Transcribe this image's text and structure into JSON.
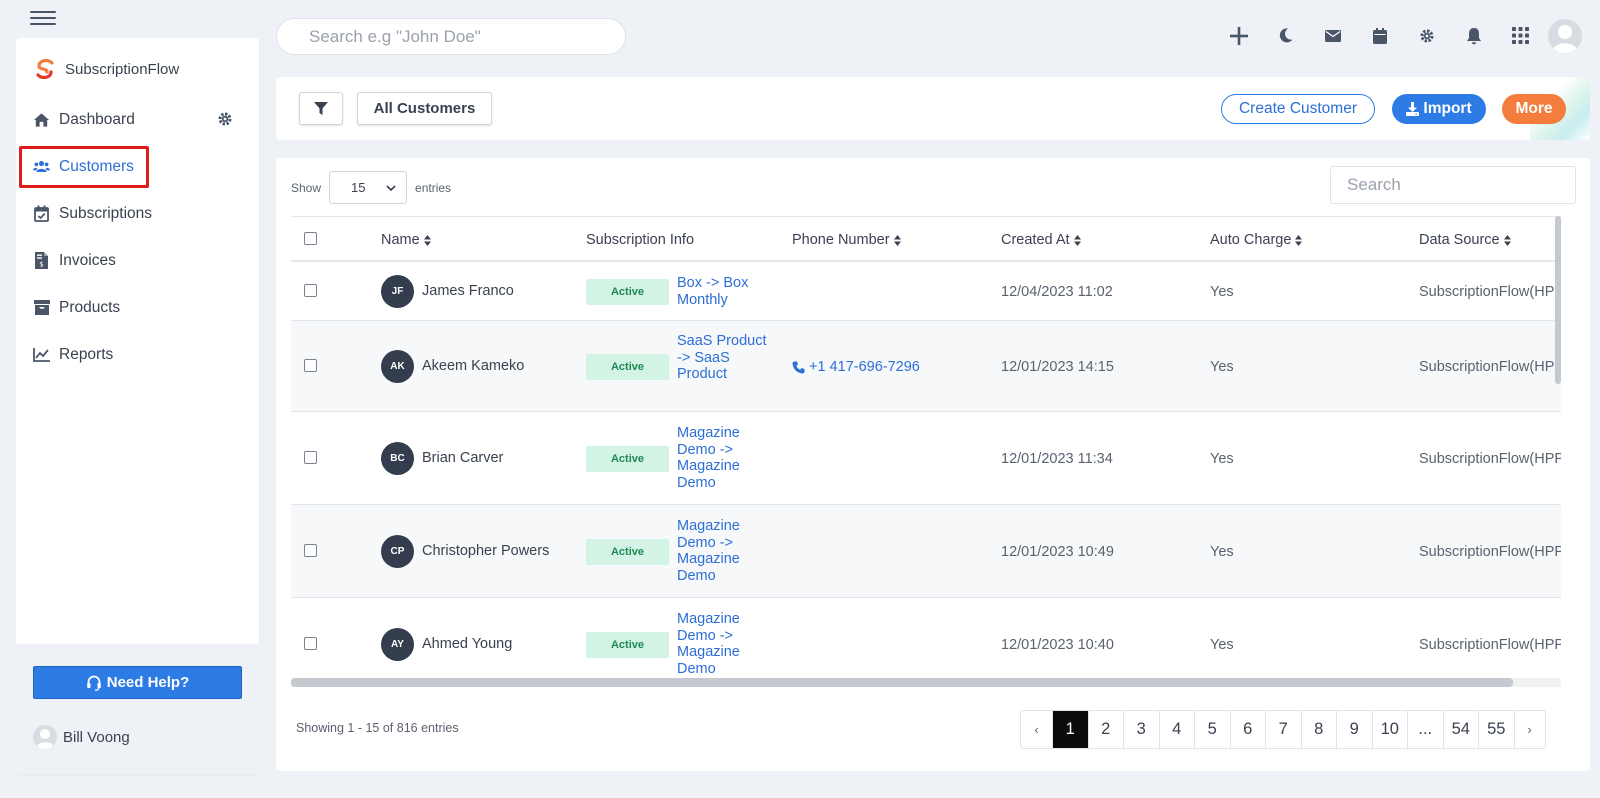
{
  "brand": {
    "name": "SubscriptionFlow"
  },
  "top_search": {
    "placeholder": "Search e.g \"John Doe\""
  },
  "sidebar": {
    "items": [
      {
        "label": "Dashboard",
        "icon": "home-icon"
      },
      {
        "label": "Customers",
        "icon": "users-icon",
        "active": true
      },
      {
        "label": "Subscriptions",
        "icon": "calendar-check-icon"
      },
      {
        "label": "Invoices",
        "icon": "invoice-icon"
      },
      {
        "label": "Products",
        "icon": "archive-icon"
      },
      {
        "label": "Reports",
        "icon": "chart-line-icon"
      }
    ],
    "help_label": "Need Help?",
    "user_name": "Bill Voong"
  },
  "toolbar": {
    "view_label": "All Customers",
    "create_label": "Create Customer",
    "import_label": "Import",
    "more_label": "More"
  },
  "table": {
    "show_label": "Show",
    "entries_value": "15",
    "entries_label": "entries",
    "search_placeholder": "Search",
    "columns": [
      "Name",
      "Subscription Info",
      "Phone Number",
      "Created At",
      "Auto Charge",
      "Data Source"
    ],
    "rows": [
      {
        "initials": "JF",
        "name": "James Franco",
        "status": "Active",
        "subscription": "Box -> Box Monthly",
        "phone": "",
        "created": "12/04/2023 11:02",
        "auto_charge": "Yes",
        "source": "SubscriptionFlow(HPP"
      },
      {
        "initials": "AK",
        "name": "Akeem Kameko",
        "status": "Active",
        "subscription": "SaaS Product -> SaaS Product",
        "phone": "+1 417-696-7296",
        "created": "12/01/2023 14:15",
        "auto_charge": "Yes",
        "source": "SubscriptionFlow(HPP"
      },
      {
        "initials": "BC",
        "name": "Brian Carver",
        "status": "Active",
        "subscription": "Magazine Demo -> Magazine Demo",
        "phone": "",
        "created": "12/01/2023 11:34",
        "auto_charge": "Yes",
        "source": "SubscriptionFlow(HPP"
      },
      {
        "initials": "CP",
        "name": "Christopher Powers",
        "status": "Active",
        "subscription": "Magazine Demo -> Magazine Demo",
        "phone": "",
        "created": "12/01/2023 10:49",
        "auto_charge": "Yes",
        "source": "SubscriptionFlow(HPP"
      },
      {
        "initials": "AY",
        "name": "Ahmed Young",
        "status": "Active",
        "subscription": "Magazine Demo -> Magazine Demo",
        "phone": "",
        "created": "12/01/2023 10:40",
        "auto_charge": "Yes",
        "source": "SubscriptionFlow(HPP"
      }
    ],
    "showing_text": "Showing 1 - 15 of 816 entries"
  },
  "pagination": {
    "prev": "‹",
    "pages": [
      "1",
      "2",
      "3",
      "4",
      "5",
      "6",
      "7",
      "8",
      "9",
      "10",
      "...",
      "54",
      "55"
    ],
    "active": "1",
    "next": "›"
  },
  "colors": {
    "accent": "#2d7be5",
    "orange": "#f47c3c",
    "active_badge_bg": "#d3f3e4",
    "highlight_border": "#e01b1b"
  }
}
